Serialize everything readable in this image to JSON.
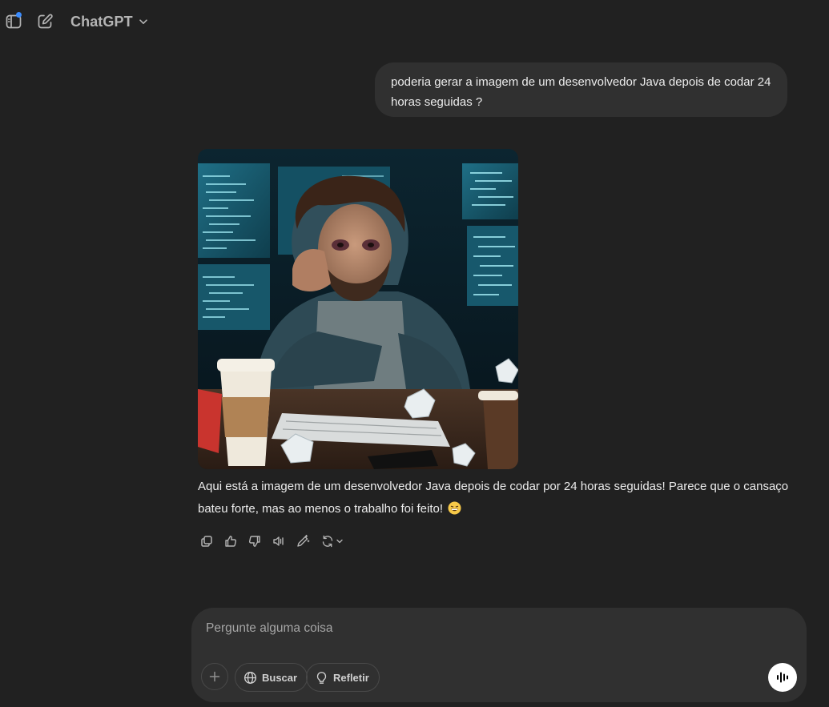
{
  "header": {
    "model_name": "ChatGPT",
    "icons": [
      "sidebar-toggle-icon",
      "new-chat-icon",
      "chevron-down-icon"
    ]
  },
  "conversation": {
    "user_message": "poderia gerar a imagem de um desenvolvedor Java depois de codar 24 horas seguidas ?",
    "assistant_message": "Aqui está a imagem de um desenvolvedor Java depois de codar por 24 horas seguidas! Parece que o cansaço bateu forte, mas ao menos o trabalho foi feito!",
    "assistant_emoji": "grinning-face-emoji",
    "action_icons": [
      "copy-icon",
      "thumbs-up-icon",
      "thumbs-down-icon",
      "read-aloud-icon",
      "edit-in-canvas-icon",
      "regenerate-icon"
    ]
  },
  "composer": {
    "placeholder": "Pergunte alguma coisa",
    "search_label": "Buscar",
    "reason_label": "Refletir"
  },
  "colors": {
    "background": "#212121",
    "bubble": "#303030",
    "text": "#ececec",
    "muted": "#b4b4b4",
    "accent_dot": "#3b8cff"
  }
}
